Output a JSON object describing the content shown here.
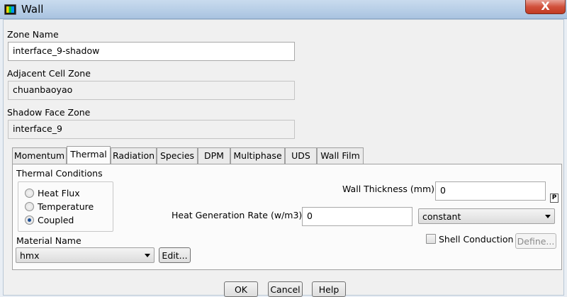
{
  "window": {
    "title": "Wall",
    "close_label": "X"
  },
  "zone_name": {
    "label": "Zone Name",
    "value": "interface_9-shadow"
  },
  "adjacent_cell_zone": {
    "label": "Adjacent Cell Zone",
    "value": "chuanbaoyao"
  },
  "shadow_face_zone": {
    "label": "Shadow Face Zone",
    "value": "interface_9"
  },
  "tabs": [
    {
      "label": "Momentum"
    },
    {
      "label": "Thermal"
    },
    {
      "label": "Radiation"
    },
    {
      "label": "Species"
    },
    {
      "label": "DPM"
    },
    {
      "label": "Multiphase"
    },
    {
      "label": "UDS"
    },
    {
      "label": "Wall Film"
    }
  ],
  "active_tab": "Thermal",
  "thermal": {
    "conditions_label": "Thermal Conditions",
    "options": [
      {
        "label": "Heat Flux",
        "checked": false
      },
      {
        "label": "Temperature",
        "checked": false
      },
      {
        "label": "Coupled",
        "checked": true
      }
    ],
    "wall_thickness": {
      "label": "Wall Thickness (mm)",
      "value": "0",
      "badge": "P"
    },
    "heat_generation": {
      "label": "Heat Generation Rate (w/m3)",
      "value": "0",
      "method": "constant"
    },
    "material": {
      "label": "Material Name",
      "value": "hmx",
      "edit_label": "Edit..."
    },
    "shell_conduction": {
      "label": "Shell Conduction",
      "checked": false,
      "define_label": "Define..."
    }
  },
  "buttons": {
    "ok": "OK",
    "cancel": "Cancel",
    "help": "Help"
  },
  "colors": {
    "titlebar": "#b6cde6",
    "close": "#d1513c",
    "radio_dot": "#1c4f95"
  }
}
